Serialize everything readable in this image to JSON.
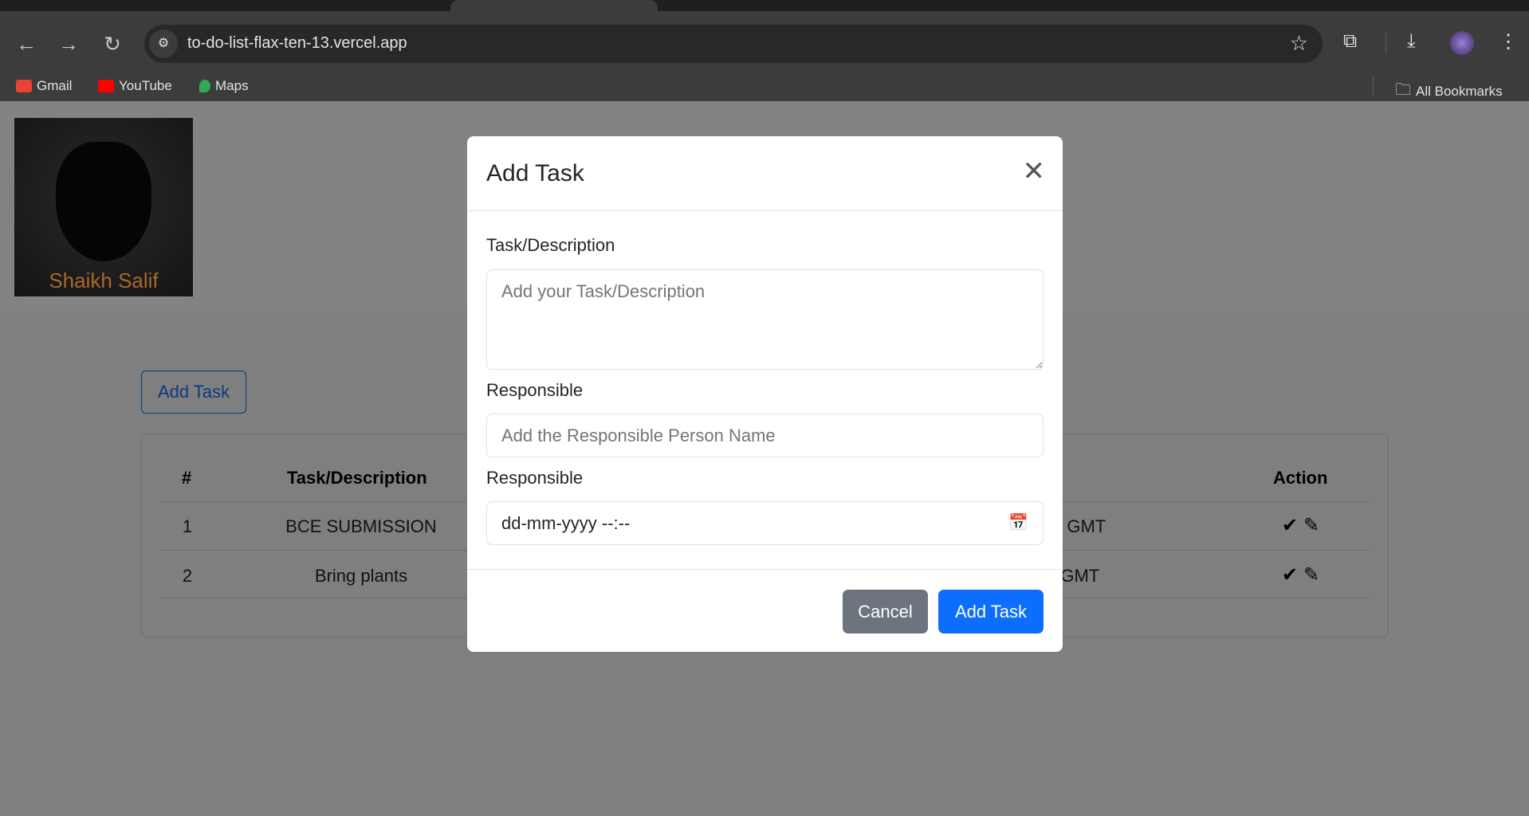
{
  "browser": {
    "url": "to-do-list-flax-ten-13.vercel.app",
    "bookmarks": [
      {
        "label": "Gmail",
        "color": "#ea4335"
      },
      {
        "label": "YouTube",
        "color": "#ff0000"
      },
      {
        "label": "Maps",
        "color": "#34a853"
      }
    ],
    "all_bookmarks": "All Bookmarks"
  },
  "page": {
    "logo_text": "Shaikh Salif",
    "add_task_button": "Add Task",
    "table": {
      "headers": [
        "#",
        "Task/Description",
        "Action"
      ],
      "rows": [
        {
          "num": "1",
          "task": "BCE SUBMISSION",
          "date_fragment": "0 GMT"
        },
        {
          "num": "2",
          "task": "Bring plants",
          "date_fragment": "0 GMT"
        }
      ]
    }
  },
  "modal": {
    "title": "Add Task",
    "task_label": "Task/Description",
    "task_placeholder": "Add your Task/Description",
    "responsible_label": "Responsible",
    "responsible_placeholder": "Add the Responsible Person Name",
    "date_label": "Responsible",
    "date_value": "dd-mm-yyyy --:--",
    "cancel": "Cancel",
    "submit": "Add Task",
    "colors": {
      "primary": "#0d6efd",
      "secondary": "#6c757d"
    }
  }
}
